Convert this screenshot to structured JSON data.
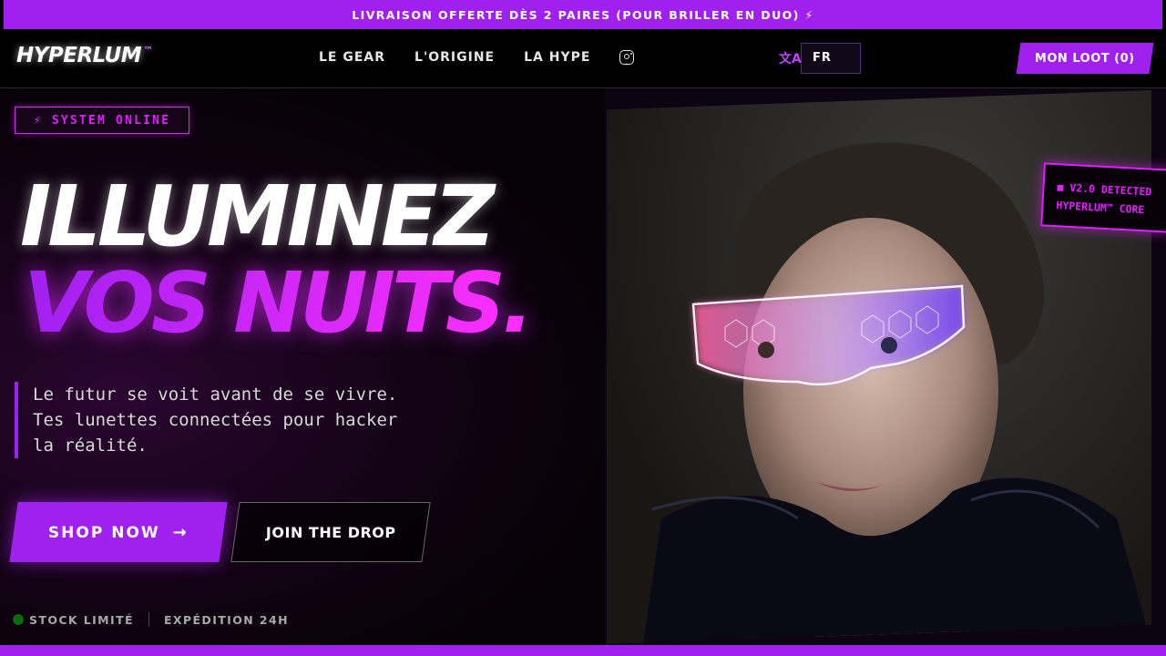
{
  "promo": {
    "text": "LIVRAISON OFFERTE DÈS 2 PAIRES (POUR BRILLER EN DUO) ⚡"
  },
  "header": {
    "logo": "HYPERLUM",
    "logo_tm": "™",
    "nav": [
      "LE GEAR",
      "L'ORIGINE",
      "LA HYPE"
    ],
    "instagram_icon": "instagram-icon",
    "translate_icon": "文A",
    "language": "FR",
    "cart_label": "MON LOOT (0)"
  },
  "hero": {
    "badge": "⚡ SYSTEM ONLINE",
    "title_line1": "ILLUMINEZ",
    "title_line2": "VOS NUITS.",
    "description_lines": [
      "Le futur se voit avant de se vivre.",
      "Tes lunettes connectées pour hacker",
      "la réalité."
    ],
    "shop_label": "SHOP NOW",
    "drop_label": "JOIN THE DROP",
    "stock_label": "STOCK LIMITÉ",
    "shipping_label": "EXPÉDITION 24H"
  },
  "product_badge": {
    "line1": "■ V2.0 DETECTED",
    "line2": "HYPERLUM™ CORE"
  },
  "colors": {
    "accent": "#a020f0",
    "neon": "#e020ff",
    "stock_dot": "#0a6a12"
  }
}
